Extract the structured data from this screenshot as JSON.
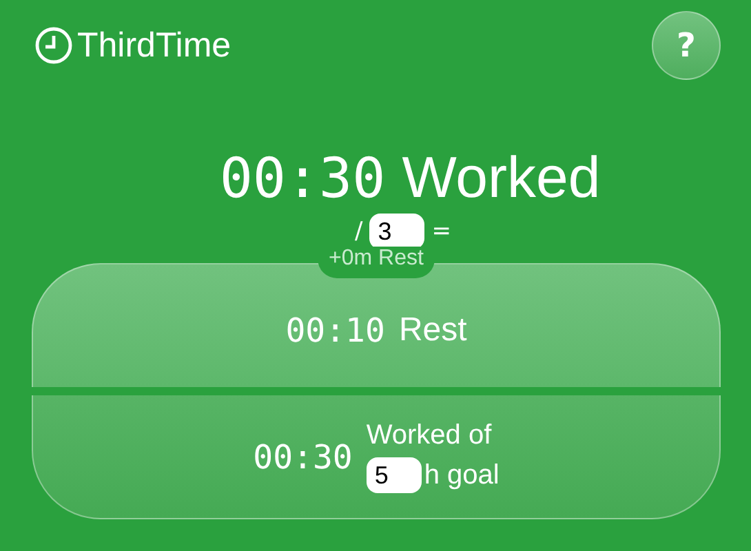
{
  "header": {
    "title": "ThirdTime",
    "help_button": "?"
  },
  "timer": {
    "time": "00:30",
    "label": "Worked"
  },
  "divisor": {
    "prefix": "/",
    "value": "3",
    "suffix": "="
  },
  "rest_bonus": "+0m Rest",
  "rest": {
    "time": "00:10",
    "label": "Rest"
  },
  "goal": {
    "time": "00:30",
    "label": "Worked of",
    "value": "5",
    "suffix": "h goal"
  }
}
